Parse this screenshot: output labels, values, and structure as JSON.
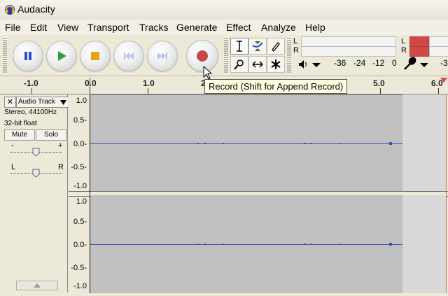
{
  "window": {
    "title": "Audacity"
  },
  "menu": [
    "File",
    "Edit",
    "View",
    "Transport",
    "Tracks",
    "Generate",
    "Effect",
    "Analyze",
    "Help"
  ],
  "transport": {
    "pause": "pause-icon",
    "play": "play-icon",
    "stop": "stop-icon",
    "skip_start": "skip-to-start-icon",
    "skip_end": "skip-to-end-icon",
    "record": "record-icon"
  },
  "tooltip": "Record (Shift for Append Record)",
  "meters": {
    "left_label": "L",
    "right_label": "R",
    "scale": [
      "-36",
      "-24",
      "-12",
      "0"
    ],
    "scale_cut": "-3"
  },
  "ruler": {
    "labels": [
      "-1.0",
      "0.0",
      "1.0",
      "2",
      "5.0",
      "6.0"
    ]
  },
  "track": {
    "name": "Audio Track",
    "info1": "Stereo, 44100Hz",
    "info2": "32-bit float",
    "mute": "Mute",
    "solo": "Solo",
    "gain_minus": "-",
    "gain_plus": "+",
    "pan_left": "L",
    "pan_right": "R",
    "close": "✕"
  },
  "vertical_scale": [
    "1.0",
    "0.5-",
    "0.0-",
    "-0.5-",
    "-1.0"
  ],
  "colors": {
    "waveform": "#3c4fb5",
    "record": "#c8474a",
    "play": "#2f9e3f",
    "pause": "#2b4fd0",
    "stop": "#e6a219"
  }
}
